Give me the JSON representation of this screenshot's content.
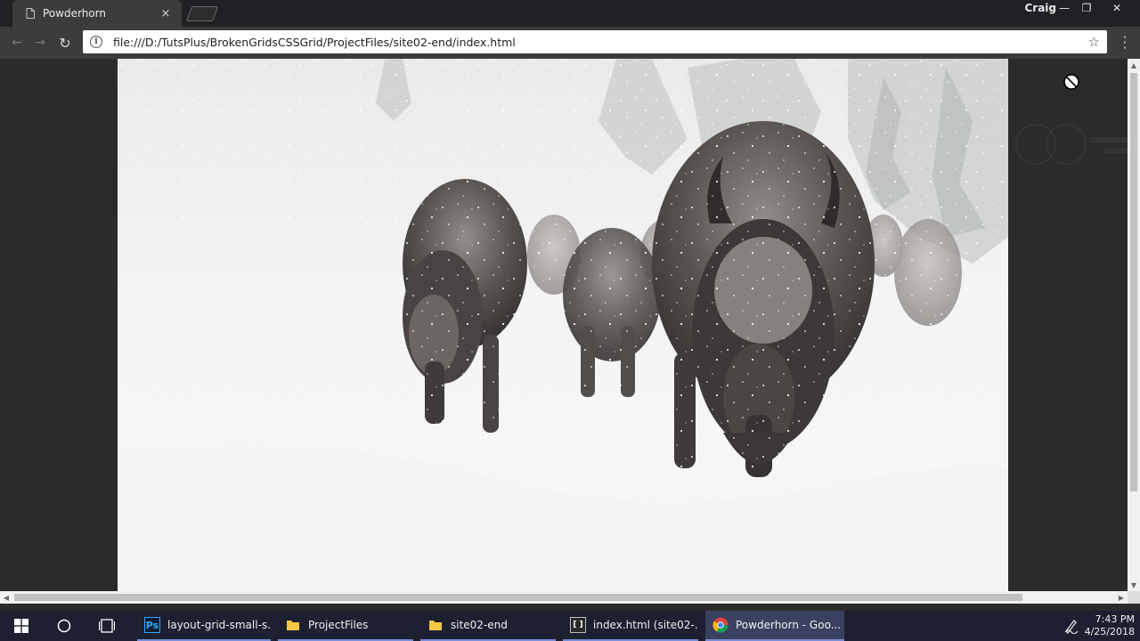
{
  "browser": {
    "tab": {
      "title": "Powderhorn",
      "close_glyph": "×"
    },
    "profile_name": "Craig",
    "window_buttons": {
      "minimize": "—",
      "restore": "❐",
      "close": "✕"
    },
    "nav": {
      "back": "←",
      "forward": "→",
      "reload": "↻"
    },
    "address": {
      "url": "file:///D:/TutsPlus/BrokenGridsCSSGrid/ProjectFiles/site02-end/index.html",
      "info": "i",
      "star": "☆"
    }
  },
  "page": {
    "hero_image": "snowy-bison-herd-photo"
  },
  "taskbar": {
    "items": [
      {
        "label": "layout-grid-small-s...",
        "icon": "photoshop-icon",
        "icon_text": "Ps"
      },
      {
        "label": "ProjectFiles",
        "icon": "folder-icon",
        "icon_text": ""
      },
      {
        "label": "site02-end",
        "icon": "folder-icon",
        "icon_text": ""
      },
      {
        "label": "index.html (site02-...",
        "icon": "brackets-icon",
        "icon_text": "[ ]"
      },
      {
        "label": "Powderhorn - Goo...",
        "icon": "chrome-icon",
        "icon_text": ""
      }
    ],
    "clock": {
      "time": "7:43 PM",
      "date": "4/25/2018"
    }
  },
  "colors": {
    "tab_bg": "#3c3c3c",
    "toolbar_bg": "#3c3c3c",
    "page_bg": "#2b2b2b",
    "taskbar_bg": "#1c2030",
    "taskbar_active": "#3a4160",
    "taskbar_underline": "#7a8cd6"
  }
}
